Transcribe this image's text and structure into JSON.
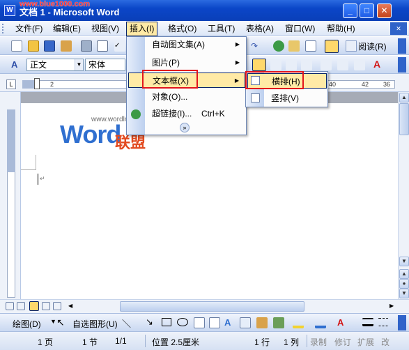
{
  "window": {
    "title": "文档 1 - Microsoft Word",
    "watermark": "www.blue1000.com"
  },
  "menubar": {
    "items": [
      "文件(F)",
      "编辑(E)",
      "视图(V)",
      "插入(I)",
      "格式(O)",
      "工具(T)",
      "表格(A)",
      "窗口(W)",
      "帮助(H)"
    ]
  },
  "toolbar_format": {
    "style": "正文",
    "font": "宋体",
    "read_label": "阅读(R)"
  },
  "ruler": {
    "ticks": [
      "2",
      "40",
      "42",
      "36"
    ]
  },
  "insert_menu": {
    "items": [
      {
        "label": "自动图文集(A)",
        "shortcut": ""
      },
      {
        "label": "图片(P)",
        "shortcut": ""
      },
      {
        "label": "文本框(X)",
        "shortcut": ""
      },
      {
        "label": "对象(O)...",
        "shortcut": ""
      },
      {
        "label": "超链接(I)...",
        "shortcut": "Ctrl+K"
      }
    ],
    "expand": "»"
  },
  "textbox_submenu": {
    "items": [
      "横排(H)",
      "竖排(V)"
    ]
  },
  "logo": {
    "word": "Word",
    "cn": "联盟",
    "url": "www.wordlm.com"
  },
  "drawbar": {
    "draw_label": "绘图(D)",
    "autoshape_label": "自选图形(U)"
  },
  "statusbar": {
    "page": "1 页",
    "section": "1 节",
    "pages": "1/1",
    "position": "位置 2.5厘米",
    "line": "1 行",
    "column": "1 列",
    "rec": "录制",
    "trk": "修订",
    "ext": "扩展",
    "ovr": "改"
  },
  "colors": {
    "title_bar": "#0b46c8",
    "menu_highlight": "#ffeaa6",
    "annotation": "#e2141c"
  }
}
